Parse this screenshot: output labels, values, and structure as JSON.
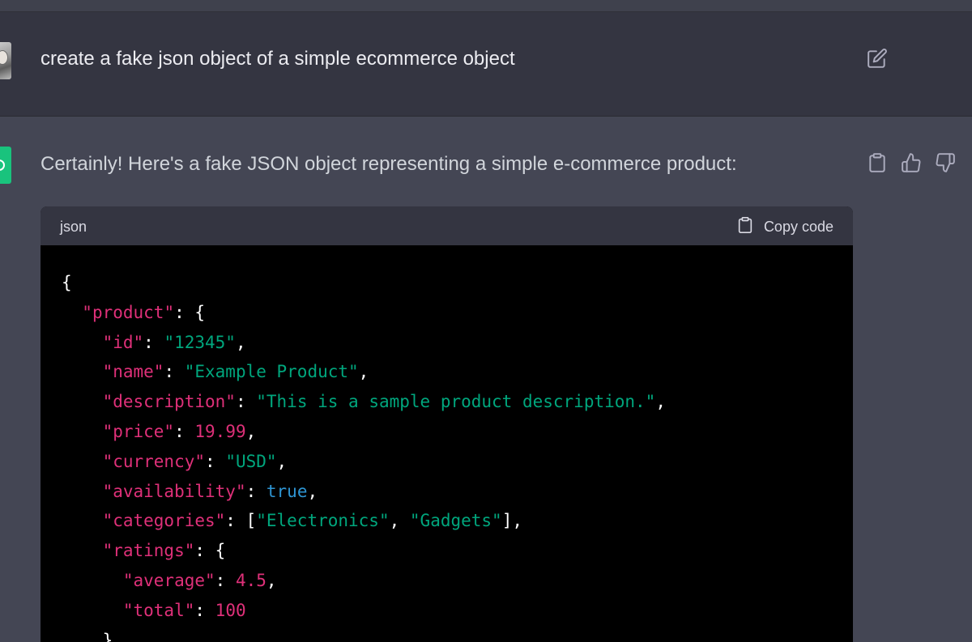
{
  "user_message": {
    "text": "create a fake json object of a simple ecommerce object"
  },
  "assistant_message": {
    "text": "Certainly! Here's a fake JSON object representing a simple e-commerce product:"
  },
  "code_block": {
    "language": "json",
    "copy_label": "Copy code",
    "lines": [
      [
        {
          "t": "p",
          "v": "{"
        }
      ],
      [
        {
          "t": "p",
          "v": "  "
        },
        {
          "t": "k",
          "v": "\"product\""
        },
        {
          "t": "p",
          "v": ": {"
        }
      ],
      [
        {
          "t": "p",
          "v": "    "
        },
        {
          "t": "k",
          "v": "\"id\""
        },
        {
          "t": "p",
          "v": ": "
        },
        {
          "t": "s",
          "v": "\"12345\""
        },
        {
          "t": "p",
          "v": ","
        }
      ],
      [
        {
          "t": "p",
          "v": "    "
        },
        {
          "t": "k",
          "v": "\"name\""
        },
        {
          "t": "p",
          "v": ": "
        },
        {
          "t": "s",
          "v": "\"Example Product\""
        },
        {
          "t": "p",
          "v": ","
        }
      ],
      [
        {
          "t": "p",
          "v": "    "
        },
        {
          "t": "k",
          "v": "\"description\""
        },
        {
          "t": "p",
          "v": ": "
        },
        {
          "t": "s",
          "v": "\"This is a sample product description.\""
        },
        {
          "t": "p",
          "v": ","
        }
      ],
      [
        {
          "t": "p",
          "v": "    "
        },
        {
          "t": "k",
          "v": "\"price\""
        },
        {
          "t": "p",
          "v": ": "
        },
        {
          "t": "n",
          "v": "19.99"
        },
        {
          "t": "p",
          "v": ","
        }
      ],
      [
        {
          "t": "p",
          "v": "    "
        },
        {
          "t": "k",
          "v": "\"currency\""
        },
        {
          "t": "p",
          "v": ": "
        },
        {
          "t": "s",
          "v": "\"USD\""
        },
        {
          "t": "p",
          "v": ","
        }
      ],
      [
        {
          "t": "p",
          "v": "    "
        },
        {
          "t": "k",
          "v": "\"availability\""
        },
        {
          "t": "p",
          "v": ": "
        },
        {
          "t": "b",
          "v": "true"
        },
        {
          "t": "p",
          "v": ","
        }
      ],
      [
        {
          "t": "p",
          "v": "    "
        },
        {
          "t": "k",
          "v": "\"categories\""
        },
        {
          "t": "p",
          "v": ": ["
        },
        {
          "t": "s",
          "v": "\"Electronics\""
        },
        {
          "t": "p",
          "v": ", "
        },
        {
          "t": "s",
          "v": "\"Gadgets\""
        },
        {
          "t": "p",
          "v": "],"
        }
      ],
      [
        {
          "t": "p",
          "v": "    "
        },
        {
          "t": "k",
          "v": "\"ratings\""
        },
        {
          "t": "p",
          "v": ": {"
        }
      ],
      [
        {
          "t": "p",
          "v": "      "
        },
        {
          "t": "k",
          "v": "\"average\""
        },
        {
          "t": "p",
          "v": ": "
        },
        {
          "t": "n",
          "v": "4.5"
        },
        {
          "t": "p",
          "v": ","
        }
      ],
      [
        {
          "t": "p",
          "v": "      "
        },
        {
          "t": "k",
          "v": "\"total\""
        },
        {
          "t": "p",
          "v": ": "
        },
        {
          "t": "n",
          "v": "100"
        }
      ],
      [
        {
          "t": "p",
          "v": "    }"
        }
      ]
    ]
  },
  "icons": {
    "edit": "edit-icon",
    "copy": "clipboard-icon",
    "like": "thumbs-up-icon",
    "dislike": "thumbs-down-icon"
  },
  "colors": {
    "user_bg": "#343541",
    "assistant_bg": "#444654",
    "code_bg": "#000000",
    "key": "#df3079",
    "string": "#00a67d",
    "boolean": "#2e95d3",
    "bot_avatar": "#19c37d"
  }
}
